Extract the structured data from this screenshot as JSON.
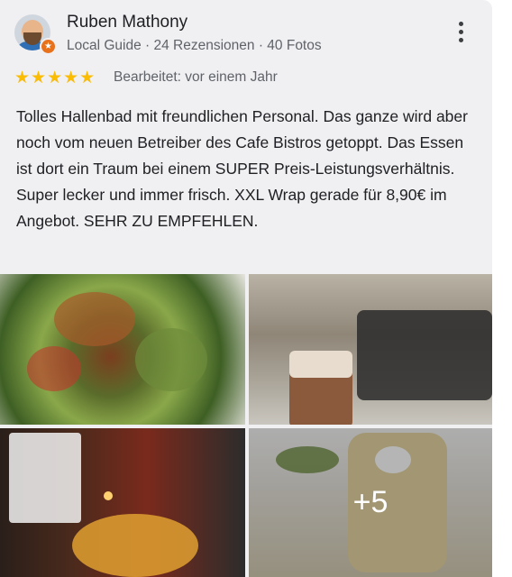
{
  "review": {
    "author_name": "Ruben Mathony",
    "author_meta": "Local Guide · 24 Rezensionen · 40 Fotos",
    "rating_stars": "★★★★★",
    "rating_value": 5,
    "edited": "Bearbeitet: vor einem Jahr",
    "text": "Tolles Hallenbad mit freundlichen Personal. Das ganze wird aber noch vom neuen Betreiber des Cafe Bistros getoppt. Das Essen ist dort ein Traum bei einem SUPER Preis-Leistungsverhältnis. Super lecker und immer frisch. XXL Wrap gerade für 8,90€ im Angebot. SEHR ZU EMPFEHLEN.",
    "more_photos_label": "+5"
  },
  "colors": {
    "star": "#fbbc04",
    "badge": "#e8711c",
    "card_bg": "#f0f0f3"
  },
  "icons": {
    "badge": "local-guide-star-badge",
    "menu": "more-vertical-icon"
  }
}
